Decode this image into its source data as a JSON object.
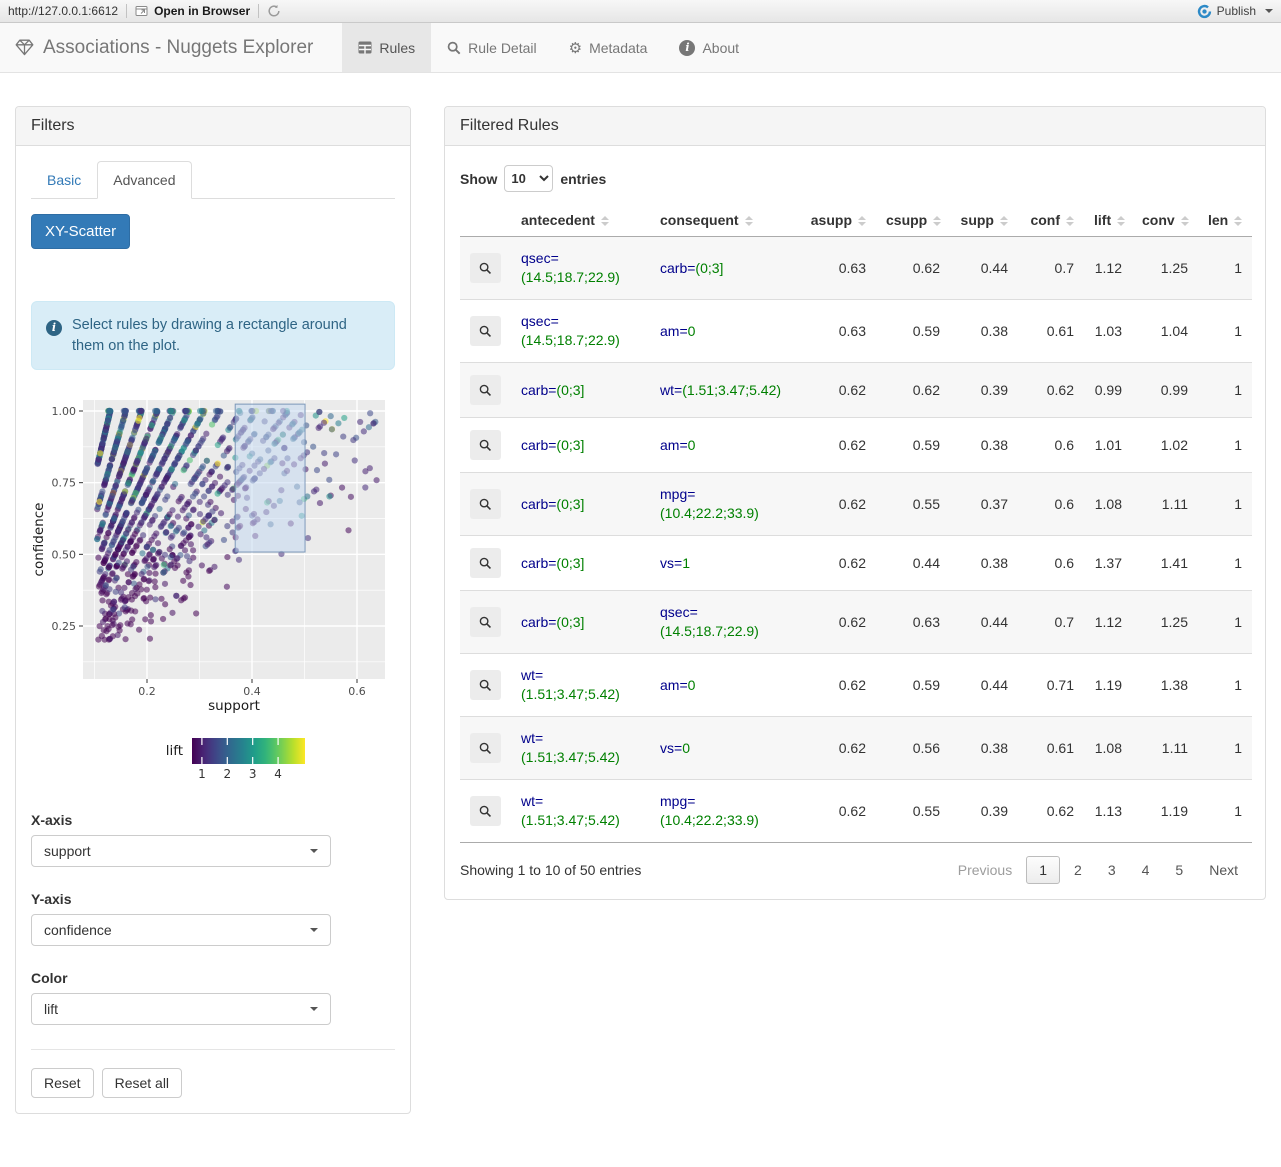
{
  "toolbar": {
    "url": "http://127.0.0.1:6612",
    "open_in_browser": "Open in Browser",
    "publish_label": "Publish"
  },
  "navbar": {
    "brand": "Associations - Nuggets Explorer",
    "tabs": [
      {
        "label": "Rules",
        "icon": "table-icon",
        "active": true
      },
      {
        "label": "Rule Detail",
        "icon": "search-icon",
        "active": false
      },
      {
        "label": "Metadata",
        "icon": "gear-icon",
        "active": false
      },
      {
        "label": "About",
        "icon": "info-icon",
        "active": false
      }
    ]
  },
  "filters": {
    "title": "Filters",
    "tabs": {
      "basic": "Basic",
      "advanced": "Advanced",
      "active": "Advanced"
    },
    "scatter_button": "XY-Scatter",
    "alert_text": "Select rules by drawing a rectangle around them on the plot.",
    "controls": [
      {
        "label": "X-axis",
        "value": "support"
      },
      {
        "label": "Y-axis",
        "value": "confidence"
      },
      {
        "label": "Color",
        "value": "lift"
      }
    ],
    "reset_label": "Reset",
    "reset_all_label": "Reset all"
  },
  "chart_data": {
    "type": "scatter",
    "xlabel": "support",
    "ylabel": "confidence",
    "xlim": [
      0.078,
      0.653
    ],
    "ylim": [
      0.065,
      1.038
    ],
    "xticks": [
      0.2,
      0.4,
      0.6
    ],
    "yticks": [
      0.25,
      0.5,
      0.75,
      1.0
    ],
    "grid": true,
    "panel_bg": "#ebebeb",
    "color_legend": {
      "label": "lift",
      "ticks": [
        1,
        2,
        3,
        4
      ],
      "palette": "viridis",
      "domain": [
        0.61,
        5.06
      ]
    },
    "selection_rect": {
      "x0": 0.368,
      "x1": 0.501,
      "y0": 0.508,
      "y1": 1.024
    },
    "points": {
      "n_cloud": 1350,
      "n_top_band": 90,
      "seed": 42,
      "note": "dense cloud of semi-transparent viridis-colored rule points; support mostly 0.1-0.35, confidence 0.1-1.0, diagonal rays conf=supp/asupp, dense band at confidence=1.0, sparse diagonal reaching (0.63,0.63); rendered procedurally from seed"
    }
  },
  "rules_table": {
    "title": "Filtered Rules",
    "show_label": "Show",
    "entries_label": "entries",
    "page_length": "10",
    "columns": [
      "antecedent",
      "consequent",
      "asupp",
      "csupp",
      "supp",
      "conf",
      "lift",
      "conv",
      "len"
    ],
    "rows": [
      {
        "antecedent": {
          "name": "qsec",
          "value": "(14.5;18.7;22.9)"
        },
        "consequent": {
          "name": "carb",
          "value": "(0;3]"
        },
        "asupp": "0.63",
        "csupp": "0.62",
        "supp": "0.44",
        "conf": "0.7",
        "lift": "1.12",
        "conv": "1.25",
        "len": "1"
      },
      {
        "antecedent": {
          "name": "qsec",
          "value": "(14.5;18.7;22.9)"
        },
        "consequent": {
          "name": "am",
          "value": "0"
        },
        "asupp": "0.63",
        "csupp": "0.59",
        "supp": "0.38",
        "conf": "0.61",
        "lift": "1.03",
        "conv": "1.04",
        "len": "1"
      },
      {
        "antecedent": {
          "name": "carb",
          "value": "(0;3]"
        },
        "consequent": {
          "name": "wt",
          "value": "(1.51;3.47;5.42)"
        },
        "asupp": "0.62",
        "csupp": "0.62",
        "supp": "0.39",
        "conf": "0.62",
        "lift": "0.99",
        "conv": "0.99",
        "len": "1"
      },
      {
        "antecedent": {
          "name": "carb",
          "value": "(0;3]"
        },
        "consequent": {
          "name": "am",
          "value": "0"
        },
        "asupp": "0.62",
        "csupp": "0.59",
        "supp": "0.38",
        "conf": "0.6",
        "lift": "1.01",
        "conv": "1.02",
        "len": "1"
      },
      {
        "antecedent": {
          "name": "carb",
          "value": "(0;3]"
        },
        "consequent": {
          "name": "mpg",
          "value": "(10.4;22.2;33.9)"
        },
        "asupp": "0.62",
        "csupp": "0.55",
        "supp": "0.37",
        "conf": "0.6",
        "lift": "1.08",
        "conv": "1.11",
        "len": "1"
      },
      {
        "antecedent": {
          "name": "carb",
          "value": "(0;3]"
        },
        "consequent": {
          "name": "vs",
          "value": "1"
        },
        "asupp": "0.62",
        "csupp": "0.44",
        "supp": "0.38",
        "conf": "0.6",
        "lift": "1.37",
        "conv": "1.41",
        "len": "1"
      },
      {
        "antecedent": {
          "name": "carb",
          "value": "(0;3]"
        },
        "consequent": {
          "name": "qsec",
          "value": "(14.5;18.7;22.9)"
        },
        "asupp": "0.62",
        "csupp": "0.63",
        "supp": "0.44",
        "conf": "0.7",
        "lift": "1.12",
        "conv": "1.25",
        "len": "1"
      },
      {
        "antecedent": {
          "name": "wt",
          "value": "(1.51;3.47;5.42)"
        },
        "consequent": {
          "name": "am",
          "value": "0"
        },
        "asupp": "0.62",
        "csupp": "0.59",
        "supp": "0.44",
        "conf": "0.71",
        "lift": "1.19",
        "conv": "1.38",
        "len": "1"
      },
      {
        "antecedent": {
          "name": "wt",
          "value": "(1.51;3.47;5.42)"
        },
        "consequent": {
          "name": "vs",
          "value": "0"
        },
        "asupp": "0.62",
        "csupp": "0.56",
        "supp": "0.38",
        "conf": "0.61",
        "lift": "1.08",
        "conv": "1.11",
        "len": "1"
      },
      {
        "antecedent": {
          "name": "wt",
          "value": "(1.51;3.47;5.42)"
        },
        "consequent": {
          "name": "mpg",
          "value": "(10.4;22.2;33.9)"
        },
        "asupp": "0.62",
        "csupp": "0.55",
        "supp": "0.39",
        "conf": "0.62",
        "lift": "1.13",
        "conv": "1.19",
        "len": "1"
      }
    ],
    "info": "Showing 1 to 10 of 50 entries",
    "pagination": {
      "previous": "Previous",
      "pages": [
        "1",
        "2",
        "3",
        "4",
        "5"
      ],
      "current": "1",
      "next": "Next"
    }
  },
  "theme": {
    "accent": "#337ab7",
    "alert_bg": "#d9edf7",
    "alert_text": "#2e6484",
    "antecedent_name_color": "#00008b",
    "antecedent_value_color": "#008000",
    "publish_blue": "#2d8ac7",
    "viridis": [
      "#440154",
      "#482878",
      "#3e4a89",
      "#31688e",
      "#26828e",
      "#1f9e89",
      "#35b779",
      "#6dcd59",
      "#b4de2c",
      "#fde725"
    ]
  }
}
